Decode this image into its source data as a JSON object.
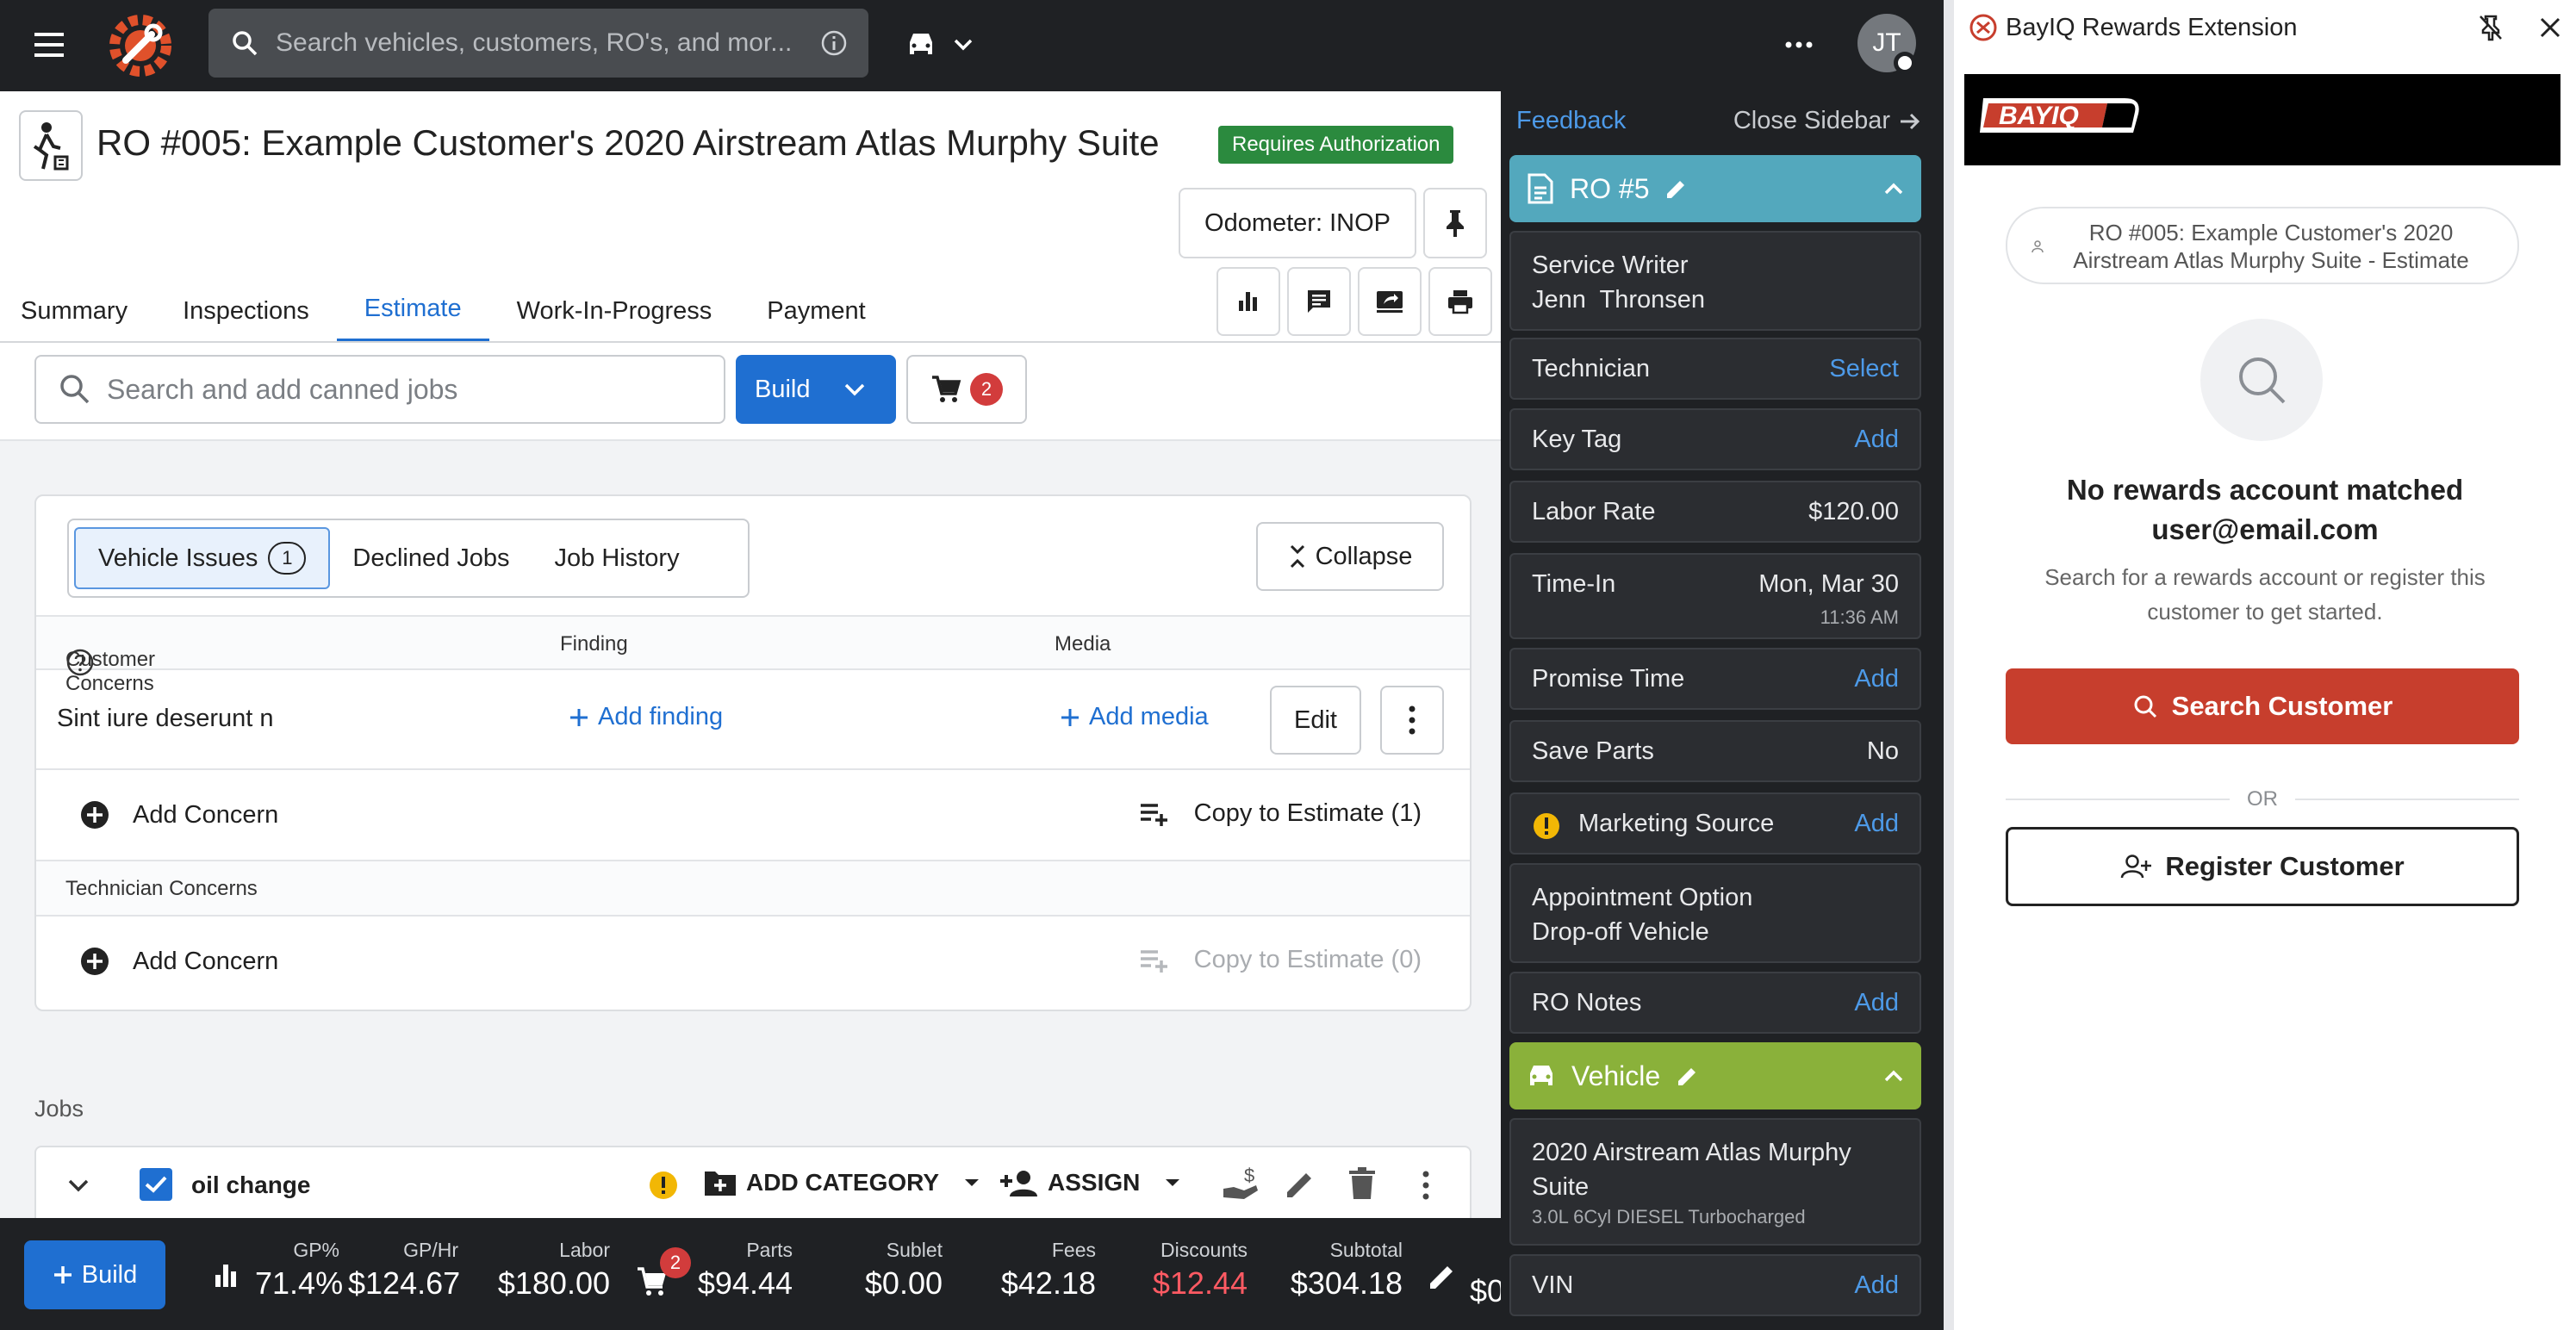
{
  "header": {
    "search_placeholder": "Search vehicles, customers, RO's, and mor...",
    "avatar_initials": "JT"
  },
  "ro": {
    "title": "RO #005: Example Customer's 2020 Airstream Atlas Murphy Suite",
    "status_badge": "Requires Authorization",
    "odometer": "Odometer: INOP"
  },
  "tabs": [
    "Summary",
    "Inspections",
    "Estimate",
    "Work-In-Progress",
    "Payment"
  ],
  "active_tab": "Estimate",
  "estimate": {
    "canned_search_placeholder": "Search and add canned jobs",
    "build_label": "Build",
    "cart_count": "2"
  },
  "issues": {
    "segments": [
      "Vehicle Issues",
      "Declined Jobs",
      "Job History"
    ],
    "vehicle_issues_count": "1",
    "collapse_label": "Collapse",
    "columns": [
      "Customer Concerns",
      "Finding",
      "Media"
    ],
    "concern_text": "Sint iure deserunt n",
    "add_finding": "Add finding",
    "add_media": "Add media",
    "edit_label": "Edit",
    "add_concern": "Add Concern",
    "copy_to_estimate_customer": "Copy to Estimate (1)",
    "technician_concerns": "Technician Concerns",
    "copy_to_estimate_tech": "Copy to Estimate (0)"
  },
  "jobs": {
    "label": "Jobs",
    "job_name": "oil change",
    "add_category": "ADD CATEGORY",
    "assign": "ASSIGN"
  },
  "totals": {
    "build_label": "Build",
    "gp_pct_label": "GP%",
    "gp_pct": "71.4%",
    "gp_hr_label": "GP/Hr",
    "gp_hr": "$124.67",
    "labor_label": "Labor",
    "labor": "$180.00",
    "parts_label": "Parts",
    "parts": "$94.44",
    "parts_badge": "2",
    "sublet_label": "Sublet",
    "sublet": "$0.00",
    "fees_label": "Fees",
    "fees": "$42.18",
    "discounts_label": "Discounts",
    "discounts": "$12.44",
    "subtotal_label": "Subtotal",
    "subtotal": "$304.18",
    "truncated": "$0"
  },
  "sidebar": {
    "feedback": "Feedback",
    "close": "Close Sidebar",
    "ro_section": "RO #5",
    "service_writer_label": "Service Writer",
    "service_writer": "Jenn  Thronsen",
    "technician_label": "Technician",
    "technician_action": "Select",
    "key_tag_label": "Key Tag",
    "labor_rate_label": "Labor Rate",
    "labor_rate": "$120.00",
    "time_in_label": "Time-In",
    "time_in_date": "Mon, Mar 30",
    "time_in_time": "11:36 AM",
    "promise_time_label": "Promise Time",
    "save_parts_label": "Save Parts",
    "save_parts": "No",
    "marketing_source_label": "Marketing Source",
    "appointment_option_label": "Appointment Option",
    "appointment_option": "Drop-off Vehicle",
    "ro_notes_label": "RO Notes",
    "add": "Add",
    "vehicle_section": "Vehicle",
    "vehicle_name": "2020 Airstream Atlas Murphy Suite",
    "vehicle_engine": "3.0L 6Cyl DIESEL Turbocharged",
    "vin_label": "VIN"
  },
  "extension": {
    "title": "BayIQ Rewards Extension",
    "banner_logo": "BAYIQ",
    "ro_chip": "RO #005: Example Customer's 2020 Airstream Atlas Murphy Suite - Estimate",
    "no_match_line1": "No rewards account matched",
    "no_match_line2": "user@email.com",
    "help_text": "Search for a rewards account or register this customer to get started.",
    "search_button": "Search Customer",
    "or": "OR",
    "register_button": "Register Customer"
  },
  "colors": {
    "accent_blue": "#1f6fd1",
    "dark_bg": "#1f2124",
    "ro_section": "#53a8bd",
    "vehicle_section": "#8ab13a",
    "badge_green": "#2b8a3e",
    "rewards_red": "#c73e2d",
    "discount_red": "#e0414a"
  }
}
